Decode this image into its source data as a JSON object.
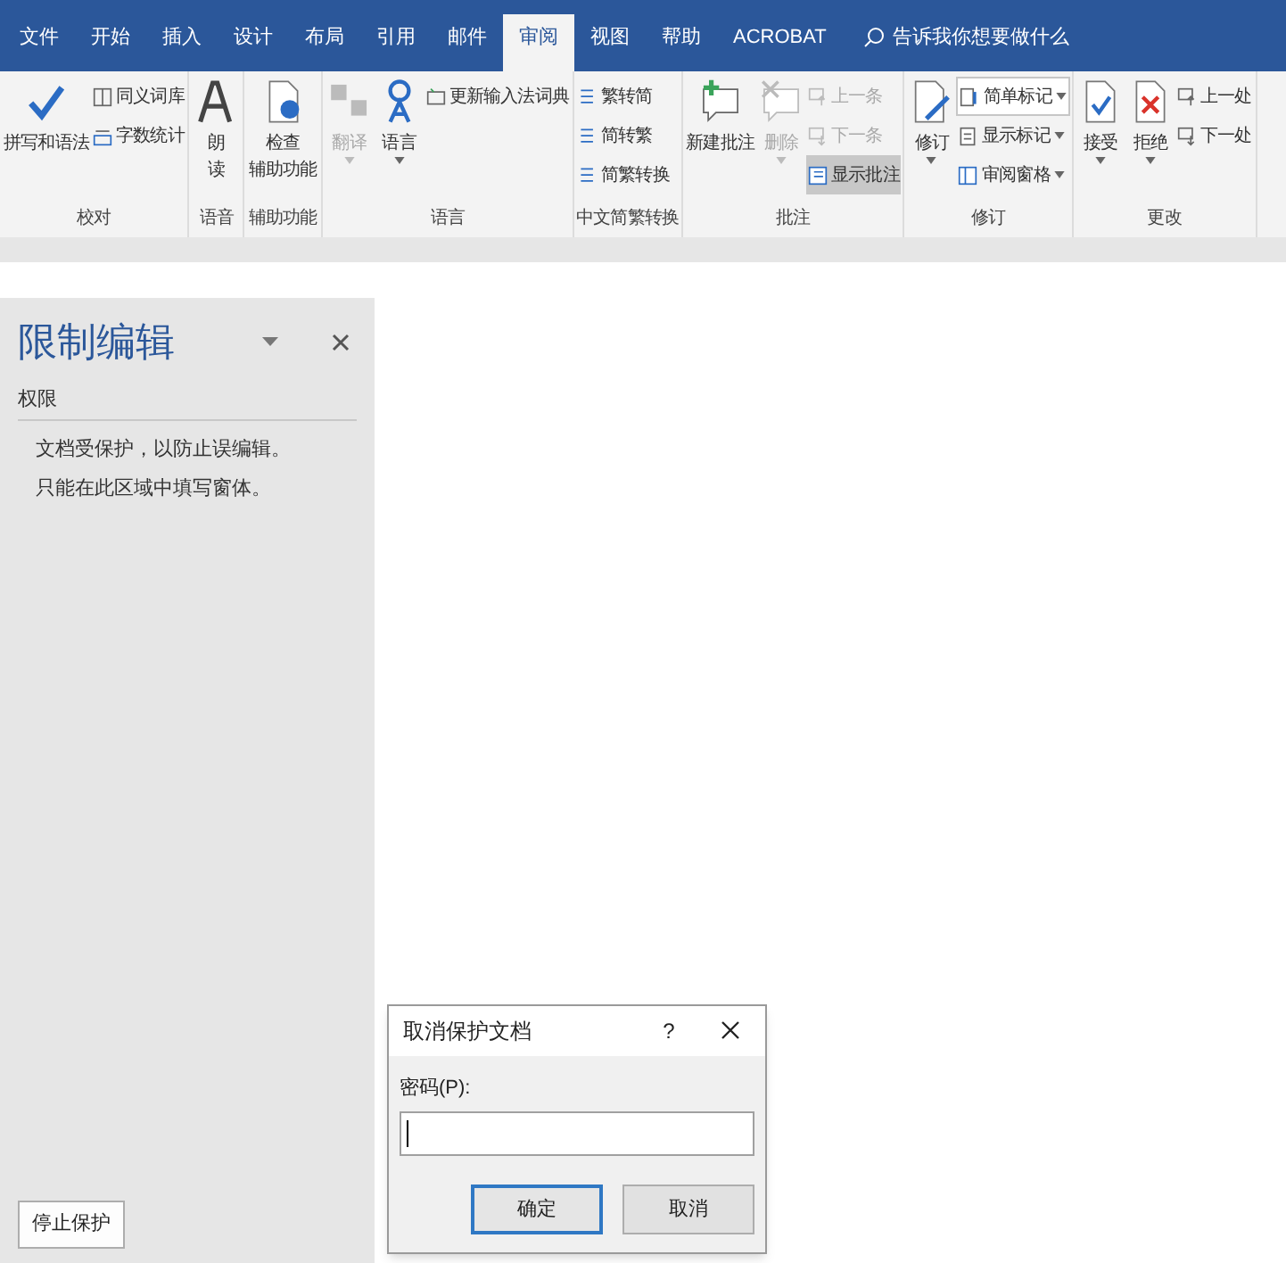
{
  "tabs": [
    {
      "label": "文件",
      "selected": false
    },
    {
      "label": "开始",
      "selected": false
    },
    {
      "label": "插入",
      "selected": false
    },
    {
      "label": "设计",
      "selected": false
    },
    {
      "label": "布局",
      "selected": false
    },
    {
      "label": "引用",
      "selected": false
    },
    {
      "label": "邮件",
      "selected": false
    },
    {
      "label": "审阅",
      "selected": true
    },
    {
      "label": "视图",
      "selected": false
    },
    {
      "label": "帮助",
      "selected": false
    },
    {
      "label": "ACROBAT",
      "selected": false
    }
  ],
  "tell_me": {
    "placeholder": "告诉我你想要做什么"
  },
  "groups": [
    {
      "label": "校对",
      "columns": [
        {
          "kind": "large",
          "lines": [
            "拼写和语法"
          ],
          "disabled": false,
          "dropdown": false
        },
        {
          "kind": "stack",
          "items": [
            {
              "kind": "button",
              "label": "同义词库",
              "disabled": false,
              "selected": false,
              "dropdown": false
            },
            {
              "kind": "button",
              "label": "字数统计",
              "disabled": false,
              "selected": false,
              "dropdown": false
            }
          ]
        }
      ]
    },
    {
      "label": "语音",
      "columns": [
        {
          "kind": "large",
          "lines": [
            "朗",
            "读"
          ],
          "disabled": false,
          "dropdown": false
        }
      ]
    },
    {
      "label": "辅助功能",
      "columns": [
        {
          "kind": "large",
          "lines": [
            "检查",
            "辅助功能"
          ],
          "disabled": false,
          "dropdown": false
        }
      ]
    },
    {
      "label": "语言",
      "columns": [
        {
          "kind": "large",
          "lines": [
            "翻译"
          ],
          "disabled": true,
          "dropdown": true
        },
        {
          "kind": "large",
          "lines": [
            "语言"
          ],
          "disabled": false,
          "dropdown": true
        },
        {
          "kind": "stack",
          "items": [
            {
              "kind": "button",
              "label": "更新输入法词典",
              "disabled": false,
              "selected": false,
              "dropdown": false
            }
          ]
        }
      ]
    },
    {
      "label": "中文简繁转换",
      "columns": [
        {
          "kind": "stack",
          "items": [
            {
              "kind": "button",
              "label": "繁转简",
              "disabled": false,
              "selected": false,
              "dropdown": false
            },
            {
              "kind": "button",
              "label": "简转繁",
              "disabled": false,
              "selected": false,
              "dropdown": false
            },
            {
              "kind": "button",
              "label": "简繁转换",
              "disabled": false,
              "selected": false,
              "dropdown": false
            }
          ]
        }
      ]
    },
    {
      "label": "批注",
      "columns": [
        {
          "kind": "large",
          "lines": [
            "新建批注"
          ],
          "disabled": false,
          "dropdown": false
        },
        {
          "kind": "large",
          "lines": [
            "删除"
          ],
          "disabled": true,
          "dropdown": true
        },
        {
          "kind": "stack",
          "items": [
            {
              "kind": "button",
              "label": "上一条",
              "disabled": true,
              "selected": false,
              "dropdown": false
            },
            {
              "kind": "button",
              "label": "下一条",
              "disabled": true,
              "selected": false,
              "dropdown": false
            },
            {
              "kind": "button",
              "label": "显示批注",
              "disabled": false,
              "selected": true,
              "dropdown": false
            }
          ]
        }
      ]
    },
    {
      "label": "修订",
      "columns": [
        {
          "kind": "large",
          "lines": [
            "修订"
          ],
          "disabled": false,
          "dropdown": true
        },
        {
          "kind": "stack",
          "items": [
            {
              "kind": "combo",
              "label": "简单标记",
              "disabled": false,
              "selected": false,
              "dropdown": true
            },
            {
              "kind": "button",
              "label": "显示标记",
              "disabled": false,
              "selected": false,
              "dropdown": true
            },
            {
              "kind": "button",
              "label": "审阅窗格",
              "disabled": false,
              "selected": false,
              "dropdown": true
            }
          ]
        }
      ]
    },
    {
      "label": "更改",
      "columns": [
        {
          "kind": "large",
          "lines": [
            "接受"
          ],
          "disabled": false,
          "dropdown": true
        },
        {
          "kind": "large",
          "lines": [
            "拒绝"
          ],
          "disabled": false,
          "dropdown": true
        },
        {
          "kind": "stack",
          "items": [
            {
              "kind": "button",
              "label": "上一处",
              "disabled": false,
              "selected": false,
              "dropdown": false
            },
            {
              "kind": "button",
              "label": "下一处",
              "disabled": false,
              "selected": false,
              "dropdown": false
            }
          ]
        }
      ]
    }
  ],
  "pane": {
    "title": "限制编辑",
    "section": "权限",
    "lines": [
      "文档受保护，以防止误编辑。",
      "只能在此区域中填写窗体。"
    ],
    "stop_button": "停止保护"
  },
  "dialog": {
    "title": "取消保护文档",
    "help": "?",
    "field_label": "密码(P):",
    "ok": "确定",
    "cancel": "取消"
  }
}
